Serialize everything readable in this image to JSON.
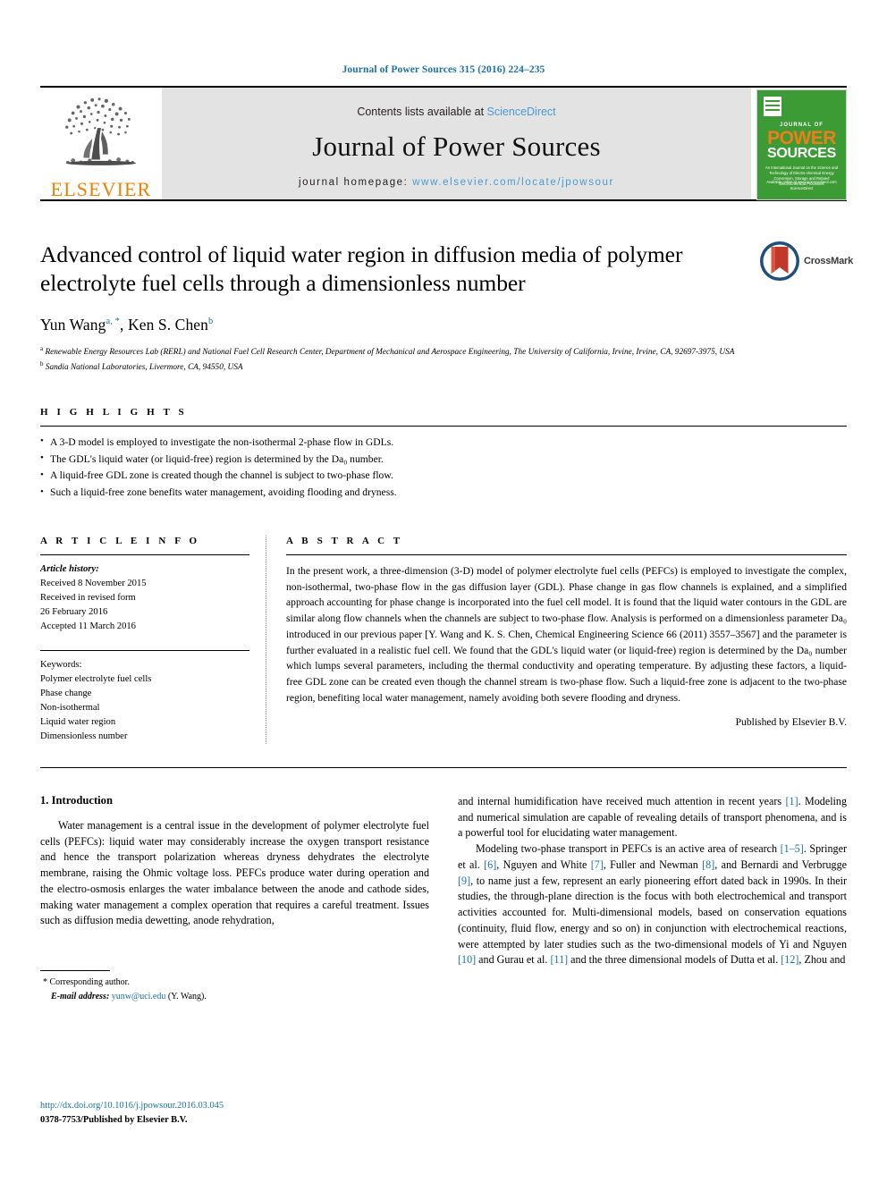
{
  "running_head": "Journal of Power Sources 315 (2016) 224–235",
  "masthead": {
    "publisher_logo_text": "ELSEVIER",
    "contents_prefix": "Contents lists available at ",
    "contents_link": "ScienceDirect",
    "journal_name": "Journal of Power Sources",
    "homepage_prefix": "journal homepage: ",
    "homepage_url": "www.elsevier.com/locate/jpowsour",
    "cover": {
      "journal_of": "JOURNAL OF",
      "power": "POWER",
      "sources": "SOURCES",
      "subtitle": "An International Journal on the Science and Technology of Electro-chemical Energy Conversion, Storage and Related Electrochemical Processes",
      "footer": "Available online at www.sciencedirect.com\nScienceDirect"
    }
  },
  "article": {
    "title": "Advanced control of liquid water region in diffusion media of polymer electrolyte fuel cells through a dimensionless number",
    "crossmark_label": "CrossMark",
    "authors": [
      {
        "name": "Yun Wang",
        "sup": "a, *"
      },
      {
        "name": "Ken S. Chen",
        "sup": "b"
      }
    ],
    "affiliations": [
      {
        "marker": "a",
        "text": "Renewable Energy Resources Lab (RERL) and National Fuel Cell Research Center, Department of Mechanical and Aerospace Engineering, The University of California, Irvine, Irvine, CA, 92697-3975, USA"
      },
      {
        "marker": "b",
        "text": "Sandia National Laboratories, Livermore, CA, 94550, USA"
      }
    ]
  },
  "highlights": {
    "heading": "H I G H L I G H T S",
    "items": [
      "A 3-D model is employed to investigate the non-isothermal 2-phase flow in GDLs.",
      "The GDL's liquid water (or liquid-free) region is determined by the Da₀ number.",
      "A liquid-free GDL zone is created though the channel is subject to two-phase flow.",
      "Such a liquid-free zone benefits water management, avoiding flooding and dryness."
    ]
  },
  "article_info": {
    "heading": "A R T I C L E  I N F O",
    "history_label": "Article history:",
    "history": [
      "Received 8 November 2015",
      "Received in revised form",
      "26 February 2016",
      "Accepted 11 March 2016"
    ],
    "keywords_label": "Keywords:",
    "keywords": [
      "Polymer electrolyte fuel cells",
      "Phase change",
      "Non-isothermal",
      "Liquid water region",
      "Dimensionless number"
    ]
  },
  "abstract": {
    "heading": "A B S T R A C T",
    "text": "In the present work, a three-dimension (3-D) model of polymer electrolyte fuel cells (PEFCs) is employed to investigate the complex, non-isothermal, two-phase flow in the gas diffusion layer (GDL). Phase change in gas flow channels is explained, and a simplified approach accounting for phase change is incorporated into the fuel cell model. It is found that the liquid water contours in the GDL are similar along flow channels when the channels are subject to two-phase flow. Analysis is performed on a dimensionless parameter Da₀ introduced in our previous paper [Y. Wang and K. S. Chen, Chemical Engineering Science 66 (2011) 3557–3567] and the parameter is further evaluated in a realistic fuel cell. We found that the GDL's liquid water (or liquid-free) region is determined by the Da₀ number which lumps several parameters, including the thermal conductivity and operating temperature. By adjusting these factors, a liquid-free GDL zone can be created even though the channel stream is two-phase flow. Such a liquid-free zone is adjacent to the two-phase region, benefiting local water management, namely avoiding both severe flooding and dryness.",
    "published_line": "Published by Elsevier B.V."
  },
  "body": {
    "section_number_title": "1. Introduction",
    "left_paragraph_1": "Water management is a central issue in the development of polymer electrolyte fuel cells (PEFCs): liquid water may considerably increase the oxygen transport resistance and hence the transport polarization whereas dryness dehydrates the electrolyte membrane, raising the Ohmic voltage loss. PEFCs produce water during operation and the electro-osmosis enlarges the water imbalance between the anode and cathode sides, making water management a complex operation that requires a careful treatment. Issues such as diffusion media dewetting, anode rehydration,",
    "right_paragraph_1_a": "and internal humidification have received much attention in recent years ",
    "right_cite_1": "[1]",
    "right_paragraph_1_b": ". Modeling and numerical simulation are capable of revealing details of transport phenomena, and is a powerful tool for elucidating water management.",
    "right_paragraph_2_parts": [
      {
        "t": "Modeling two-phase transport in PEFCs is an active area of research "
      },
      {
        "t": "[1–5]",
        "cite": true
      },
      {
        "t": ". Springer et al. "
      },
      {
        "t": "[6]",
        "cite": true
      },
      {
        "t": ", Nguyen and White "
      },
      {
        "t": "[7]",
        "cite": true
      },
      {
        "t": ", Fuller and Newman "
      },
      {
        "t": "[8]",
        "cite": true
      },
      {
        "t": ", and Bernardi and Verbrugge "
      },
      {
        "t": "[9]",
        "cite": true
      },
      {
        "t": ", to name just a few, represent an early pioneering effort dated back in 1990s. In their studies, the through-plane direction is the focus with both electrochemical and transport activities accounted for. Multi-dimensional models, based on conservation equations (continuity, fluid flow, energy and so on) in conjunction with electrochemical reactions, were attempted by later studies such as the two-dimensional models of Yi and Nguyen "
      },
      {
        "t": "[10]",
        "cite": true
      },
      {
        "t": " and Gurau et al. "
      },
      {
        "t": "[11]",
        "cite": true
      },
      {
        "t": " and the three dimensional models of Dutta et al. "
      },
      {
        "t": "[12]",
        "cite": true
      },
      {
        "t": ", Zhou and"
      }
    ]
  },
  "footnote": {
    "corresponding_marker": "*",
    "corresponding_text": "Corresponding author.",
    "email_label": "E-mail address:",
    "email": "yunw@uci.edu",
    "email_owner": "(Y. Wang)."
  },
  "bottom": {
    "doi": "http://dx.doi.org/10.1016/j.jpowsour.2016.03.045",
    "issn_line": "0378-7753/Published by Elsevier B.V."
  },
  "colors": {
    "link_blue": "#1a72a8",
    "science_direct_blue": "#4a9bd1",
    "elsevier_orange": "#f08000",
    "cover_green": "#3d9b35",
    "banner_gray": "#e3e3e3"
  }
}
